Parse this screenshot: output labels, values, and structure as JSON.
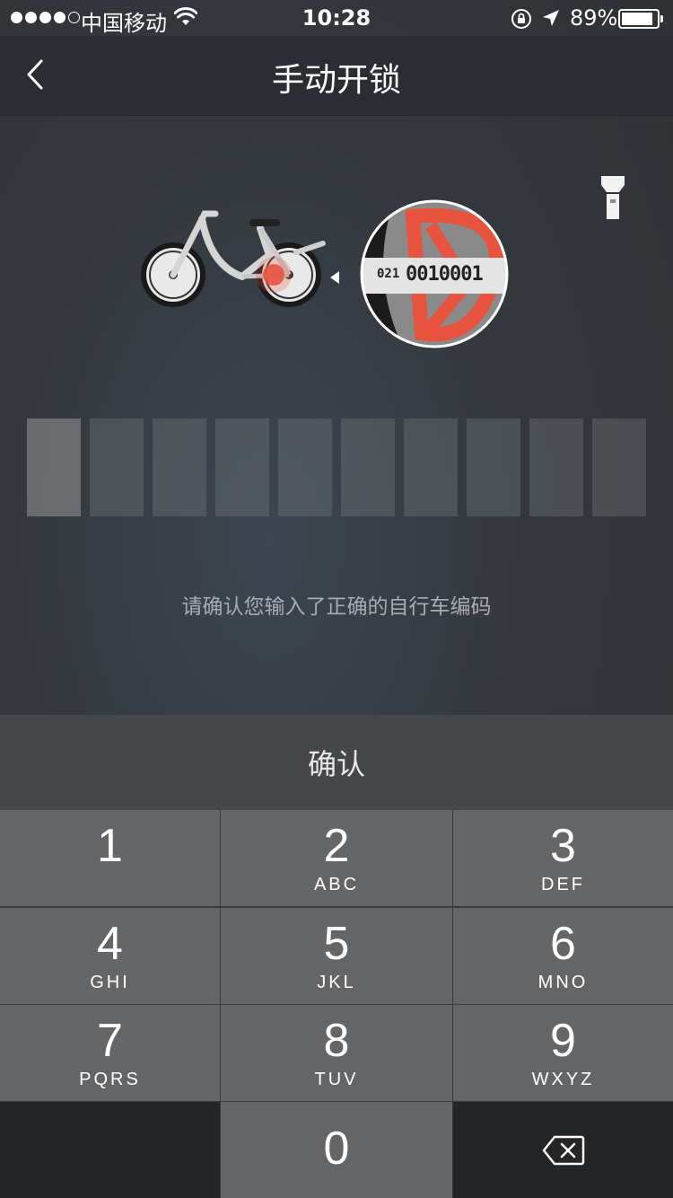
{
  "status_bar": {
    "carrier": "中国移动",
    "time": "10:28",
    "battery_percent": "89%",
    "battery_level": 0.89,
    "signal_bars_filled": 4,
    "signal_bars_total": 5
  },
  "nav": {
    "title": "手动开锁",
    "back_icon": "chevron-left-icon"
  },
  "lock_plate": {
    "prefix": "021",
    "code": "0010001"
  },
  "code_input": {
    "length": 10,
    "filled": 0
  },
  "hint": "请确认您输入了正确的自行车编码",
  "confirm_label": "确认",
  "keypad": [
    {
      "num": "1",
      "letters": ""
    },
    {
      "num": "2",
      "letters": "ABC"
    },
    {
      "num": "3",
      "letters": "DEF"
    },
    {
      "num": "4",
      "letters": "GHI"
    },
    {
      "num": "5",
      "letters": "JKL"
    },
    {
      "num": "6",
      "letters": "MNO"
    },
    {
      "num": "7",
      "letters": "PQRS"
    },
    {
      "num": "8",
      "letters": "TUV"
    },
    {
      "num": "9",
      "letters": "WXYZ"
    },
    {
      "num": "0",
      "letters": ""
    }
  ],
  "colors": {
    "accent_red": "#e8533f",
    "key_bg": "#646566",
    "confirm_bg": "#46474a"
  }
}
